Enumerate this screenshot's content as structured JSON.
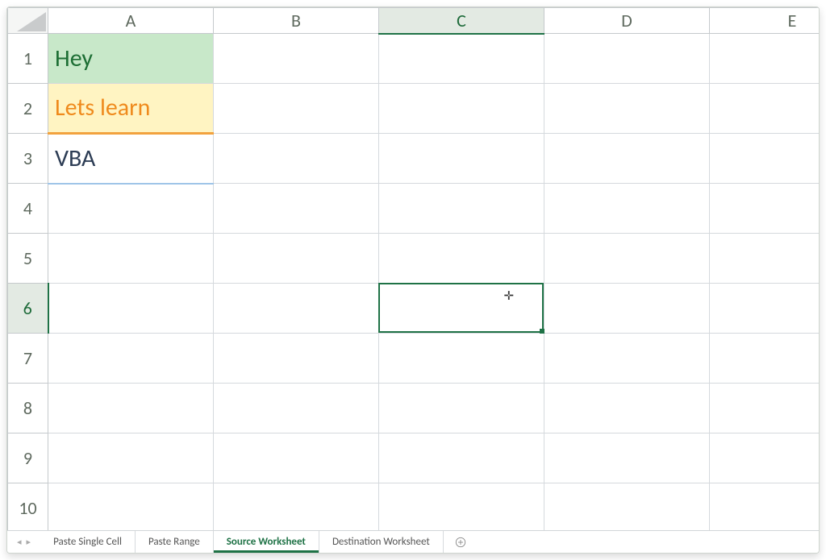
{
  "columns": [
    "A",
    "B",
    "C",
    "D",
    "E"
  ],
  "rows": [
    "1",
    "2",
    "3",
    "4",
    "5",
    "6",
    "7",
    "8",
    "9",
    "10"
  ],
  "selected_col_index": 2,
  "selected_row_index": 5,
  "cells": {
    "A1": "Hey",
    "A2": "Lets learn",
    "A3": "VBA"
  },
  "tabs": [
    {
      "label": "Paste Single Cell",
      "active": false
    },
    {
      "label": "Paste Range",
      "active": false
    },
    {
      "label": "Source Worksheet",
      "active": true
    },
    {
      "label": "Destination Worksheet",
      "active": false
    }
  ],
  "icons": {
    "nav_prev": "◂",
    "nav_next": "▸"
  },
  "colors": {
    "accent": "#1f7246",
    "a1_bg": "#c8e8c9",
    "a1_fg": "#1d6e34",
    "a2_bg": "#fff4c2",
    "a2_fg": "#ef8a1c",
    "a3_fg": "#2d3d55"
  }
}
